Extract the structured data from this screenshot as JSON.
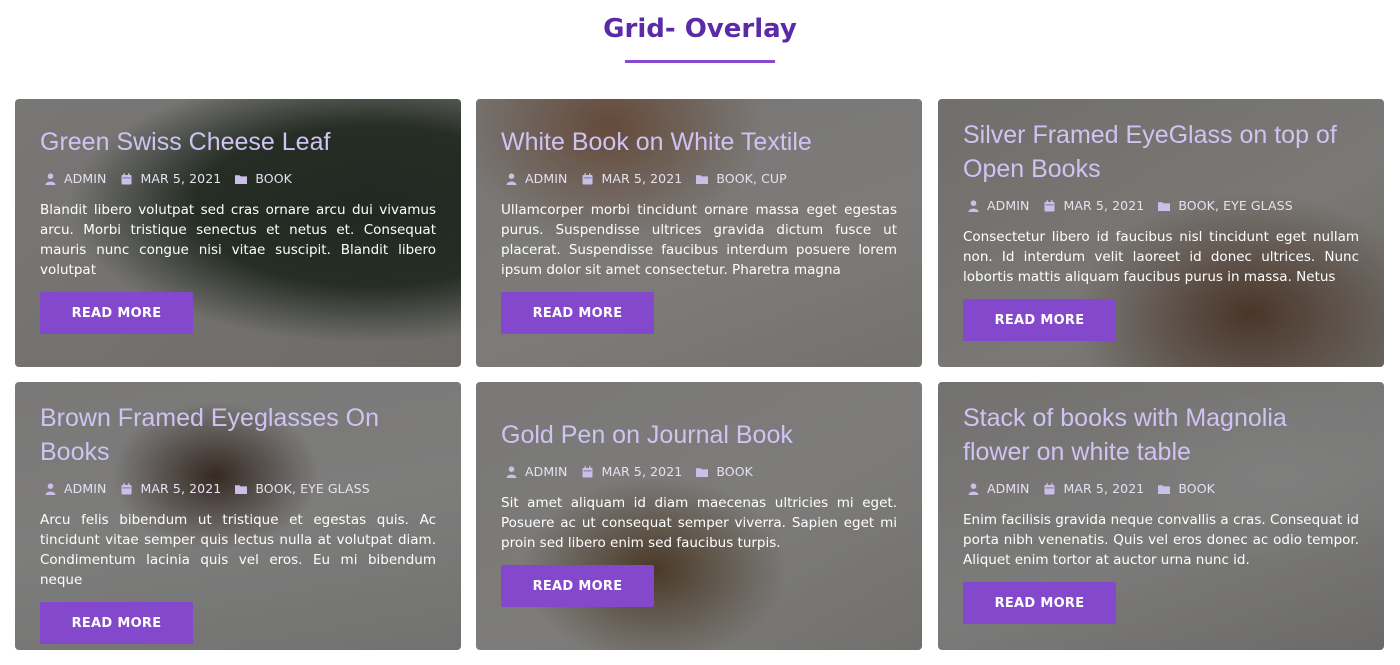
{
  "section": {
    "title": "Grid- Overlay"
  },
  "colors": {
    "accent": "#8348cc",
    "title": "#5b2aa6",
    "card_title": "#cfc3f2"
  },
  "icons": {
    "author": "user-icon",
    "date": "calendar-icon",
    "category": "folder-icon"
  },
  "cards": [
    {
      "title": "Green Swiss Cheese Leaf",
      "author": "ADMIN",
      "date": "MAR 5, 2021",
      "categories": "BOOK",
      "excerpt": "Blandit libero volutpat sed cras ornare arcu dui vivamus arcu. Morbi tristique senectus et netus et. Consequat mauris nunc congue nisi vitae suscipit. Blandit libero volutpat",
      "button": "READ MORE"
    },
    {
      "title": "White Book on White Textile",
      "author": "ADMIN",
      "date": "MAR 5, 2021",
      "categories": "BOOK, CUP",
      "excerpt": "Ullamcorper morbi tincidunt ornare massa eget egestas purus. Suspendisse ultrices gravida dictum fusce ut placerat. Suspendisse faucibus interdum posuere lorem ipsum dolor sit amet consectetur. Pharetra magna",
      "button": "READ MORE"
    },
    {
      "title": "Silver Framed EyeGlass on top of Open Books",
      "author": "ADMIN",
      "date": "MAR 5, 2021",
      "categories": "BOOK, EYE GLASS",
      "excerpt": "Consectetur libero id faucibus nisl tincidunt eget nullam non. Id interdum velit laoreet id donec ultrices. Nunc lobortis mattis aliquam faucibus purus in massa. Netus",
      "button": "READ MORE"
    },
    {
      "title": "Brown Framed Eyeglasses On Books",
      "author": "ADMIN",
      "date": "MAR 5, 2021",
      "categories": "BOOK, EYE GLASS",
      "excerpt": "Arcu felis bibendum ut tristique et egestas quis. Ac tincidunt vitae semper quis lectus nulla at volutpat diam. Condimentum lacinia quis vel eros. Eu mi bibendum neque",
      "button": "READ MORE"
    },
    {
      "title": "Gold Pen on Journal Book",
      "author": "ADMIN",
      "date": "MAR 5, 2021",
      "categories": "BOOK",
      "excerpt": "Sit amet aliquam id diam maecenas ultricies mi eget. Posuere ac ut consequat semper viverra. Sapien eget mi proin sed libero enim sed faucibus turpis.",
      "button": "READ MORE"
    },
    {
      "title": "Stack of books with Magnolia flower on white table",
      "author": "ADMIN",
      "date": "MAR 5, 2021",
      "categories": "BOOK",
      "excerpt": "Enim facilisis gravida neque convallis a cras. Consequat id porta nibh venenatis. Quis vel eros donec ac odio tempor. Aliquet enim tortor at auctor urna nunc id.",
      "button": "READ MORE"
    }
  ]
}
